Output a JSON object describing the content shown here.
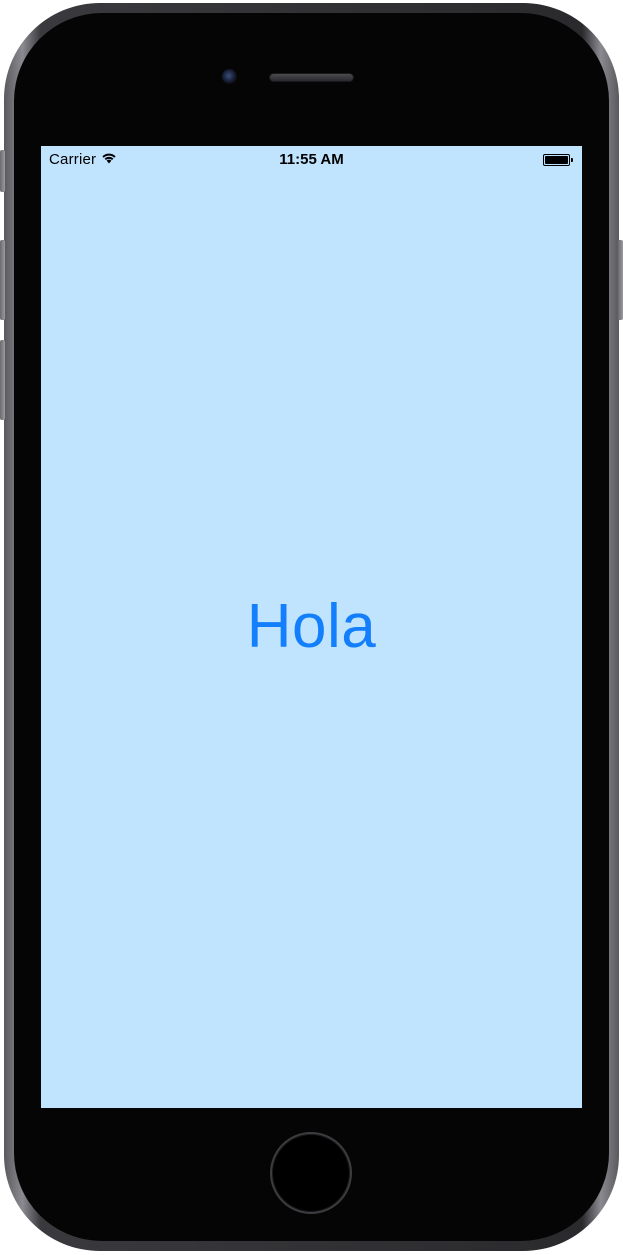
{
  "status_bar": {
    "carrier": "Carrier",
    "time": "11:55 AM",
    "battery_level": 1.0
  },
  "screen": {
    "background_color": "#c0e3fe",
    "greeting": "Hola",
    "greeting_color": "#147ffc"
  },
  "device": {
    "frame_color": "#050505",
    "icons": [
      "wifi-icon",
      "battery-icon",
      "camera-icon",
      "speaker-icon",
      "home-button"
    ]
  }
}
